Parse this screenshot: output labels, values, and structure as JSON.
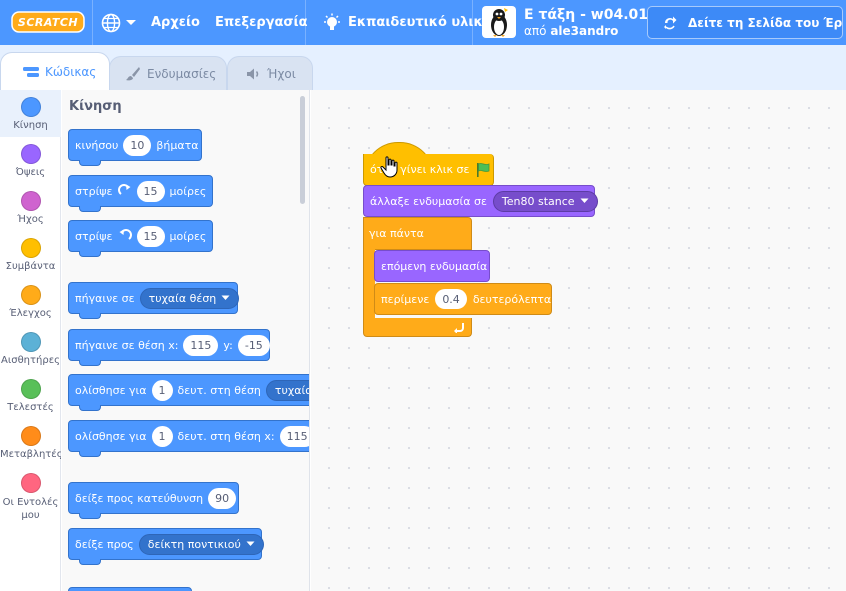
{
  "menubar": {
    "logo_text": "SCRATCH",
    "file": "Αρχείο",
    "edit": "Επεξεργασία",
    "tutorials": "Εκπαιδευτικό υλικό",
    "project_title": "Ε τάξη - w04.01",
    "author_prefix": "από",
    "author": "ale3andro",
    "see_project_page": "Δείτε τη Σελίδα του Έργου",
    "colors": {
      "bar": "#4c97ff"
    }
  },
  "tabs": [
    {
      "label": "Κώδικας",
      "active": true,
      "icon": "code-icon"
    },
    {
      "label": "Ενδυμασίες",
      "active": false,
      "icon": "brush-icon"
    },
    {
      "label": "Ήχοι",
      "active": false,
      "icon": "speaker-icon"
    }
  ],
  "categories": [
    {
      "label": "Κίνηση",
      "color": "#4c97ff"
    },
    {
      "label": "Όψεις",
      "color": "#9966ff"
    },
    {
      "label": "Ήχος",
      "color": "#cf63cf"
    },
    {
      "label": "Συμβάντα",
      "color": "#ffbf00"
    },
    {
      "label": "Έλεγχος",
      "color": "#ffab19"
    },
    {
      "label": "Αισθητήρες",
      "color": "#5cb1d6"
    },
    {
      "label": "Τελεστές",
      "color": "#59c059"
    },
    {
      "label": "Μεταβλητές",
      "color": "#ff8c1a"
    },
    {
      "label": "Οι Εντολές μου",
      "color": "#ff6680"
    }
  ],
  "palette": {
    "heading": "Κίνηση",
    "move": {
      "a": "κινήσου",
      "n": "10",
      "b": "βήματα"
    },
    "turn_right": {
      "a": "στρίψε",
      "n": "15",
      "b": "μοίρες"
    },
    "turn_left": {
      "a": "στρίψε",
      "n": "15",
      "b": "μοίρες"
    },
    "goto": {
      "a": "πήγαινε σε",
      "opt": "τυχαία θέση"
    },
    "goto_xy": {
      "a": "πήγαινε σε θέση x:",
      "x": "115",
      "yl": "y:",
      "y": "-15"
    },
    "glide": {
      "a": "ολίσθησε για",
      "n": "1",
      "b": "δευτ. στη θέση",
      "opt": "τυχαία θέση"
    },
    "glide_xy": {
      "a": "ολίσθησε για",
      "n": "1",
      "b": "δευτ. στη θέση x:",
      "x": "115"
    },
    "point_dir": {
      "a": "δείξε προς κατεύθυνση",
      "n": "90"
    },
    "point_towards": {
      "a": "δείξε προς",
      "opt": "δείκτη ποντικιού"
    }
  },
  "script": {
    "hat": {
      "a": "όταν γίνει κλικ σε"
    },
    "costume": {
      "a": "άλλαξε ενδυμασία σε",
      "opt": "Ten80 stance"
    },
    "forever": {
      "a": "για πάντα"
    },
    "next_costume": {
      "a": "επόμενη ενδυμασία"
    },
    "wait": {
      "a": "περίμενε",
      "n": "0.4",
      "b": "δευτερόλεπτα"
    }
  }
}
